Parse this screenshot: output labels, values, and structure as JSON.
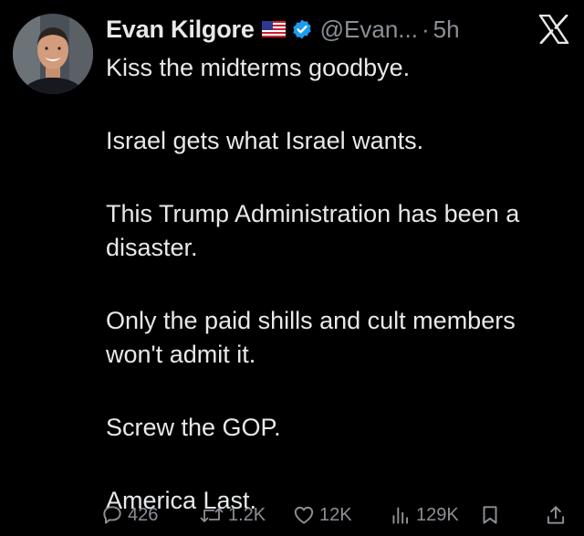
{
  "tweet": {
    "author": {
      "name": "Evan Kilgore",
      "handle": "@Evan...",
      "separator": "·",
      "time": "5h",
      "flag": "us-flag-icon",
      "verified": "verified-badge-icon"
    },
    "paragraphs": [
      "Kiss the midterms goodbye.",
      "Israel gets what Israel wants.",
      "This Trump Administration has been a disaster.",
      "Only the paid shills and cult members won't admit it.",
      "Screw the GOP.",
      "America Last."
    ],
    "actions": {
      "replies": "426",
      "reposts": "1.2K",
      "likes": "12K",
      "views": "129K"
    }
  },
  "colors": {
    "background": "#000000",
    "text": "#e7e9ea",
    "secondary": "#8b9096",
    "verified": "#1d9bf0"
  }
}
